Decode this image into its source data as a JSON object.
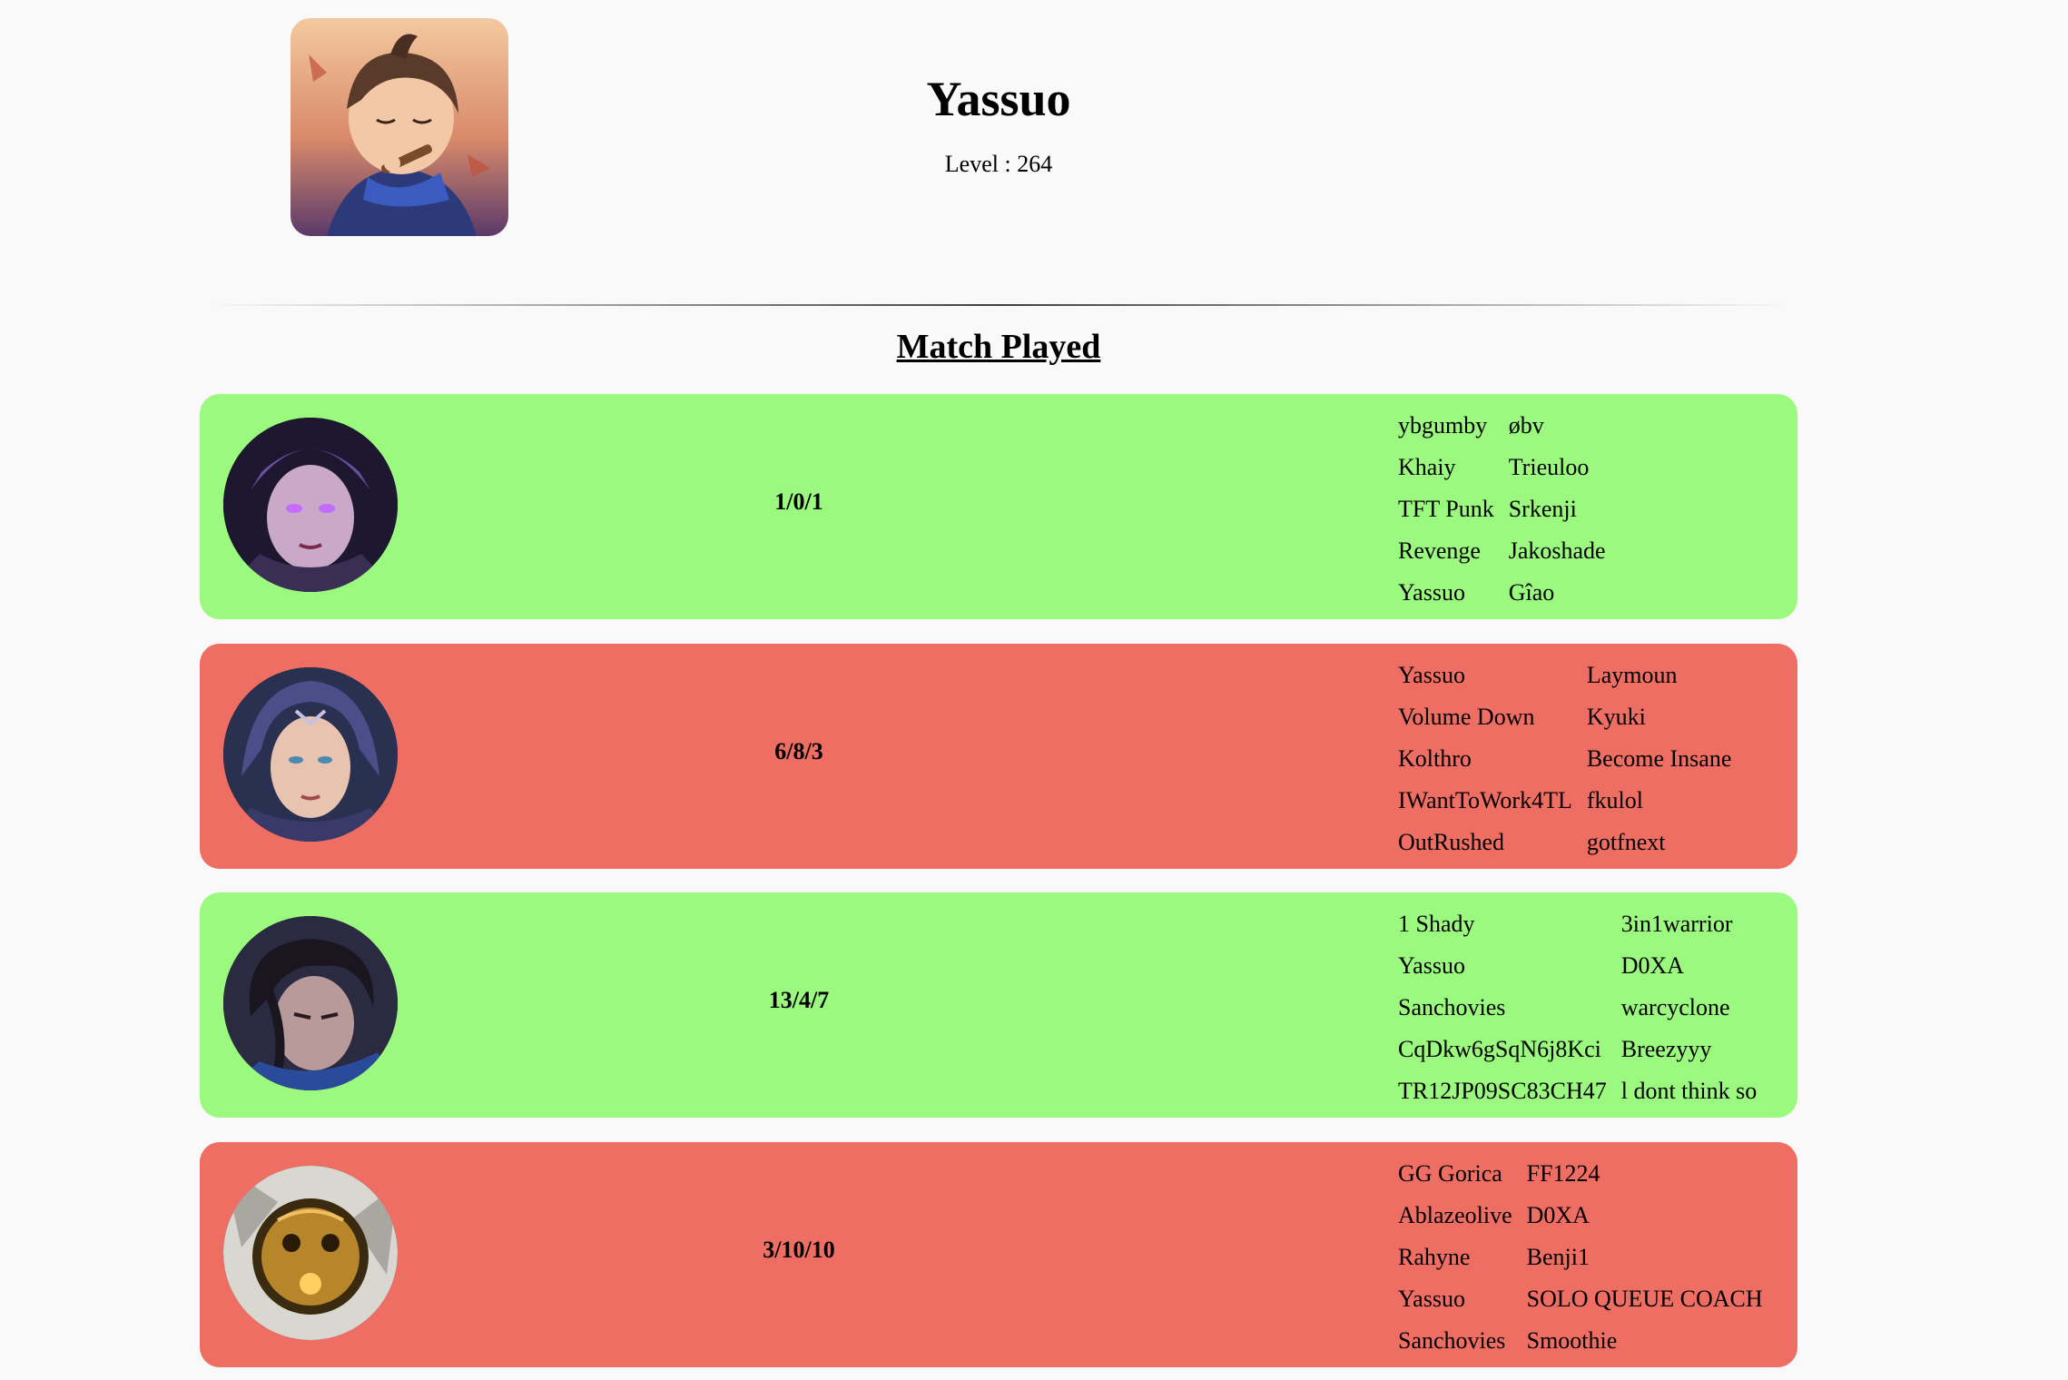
{
  "profile": {
    "name": "Yassuo",
    "level_text": "Level : 264",
    "icon": "yasuo-avatar-icon"
  },
  "section_title": "Match Played",
  "colors": {
    "win": "#9bf97f",
    "loss": "#ef6e63",
    "background": "#f9f9f9"
  },
  "matches": [
    {
      "result": "win",
      "champion_icon": "champion-portrait-icon",
      "kda": "1/0/1",
      "team1": [
        "ybgumby",
        "Khaiy",
        "TFT Punk",
        "Revenge",
        "Yassuo"
      ],
      "team2": [
        "øbv",
        "Trieuloo",
        "Srkenji",
        "Jakoshade",
        "Gîao"
      ]
    },
    {
      "result": "loss",
      "champion_icon": "champion-portrait-icon",
      "kda": "6/8/3",
      "team1": [
        "Yassuo",
        "Volume Down",
        "Kolthro",
        "IWantToWork4TL",
        "OutRushed"
      ],
      "team2": [
        "Laymoun",
        "Kyuki",
        "Become Insane",
        "fkulol",
        "gotfnext"
      ]
    },
    {
      "result": "win",
      "champion_icon": "champion-portrait-icon",
      "kda": "13/4/7",
      "team1": [
        "1 Shady",
        "Yassuo",
        "Sanchovies",
        "CqDkw6gSqN6j8Kci",
        "TR12JP09SC83CH47"
      ],
      "team2": [
        "3in1warrior",
        "D0XA",
        "warcyclone",
        "Breezyyy",
        "l dont think so"
      ]
    },
    {
      "result": "loss",
      "champion_icon": "champion-portrait-icon",
      "kda": "3/10/10",
      "team1": [
        "GG Gorica",
        "Ablazeolive",
        "Rahyne",
        "Yassuo",
        "Sanchovies"
      ],
      "team2": [
        "FF1224",
        "D0XA",
        "Benji1",
        "SOLO QUEUE COACH",
        "Smoothie"
      ]
    }
  ]
}
